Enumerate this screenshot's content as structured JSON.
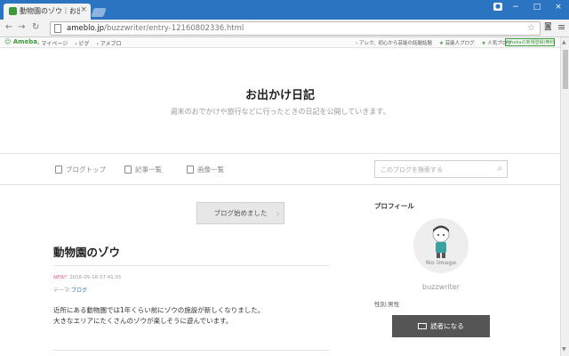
{
  "browser": {
    "tab_title": "動物園のゾウ｜お出かけ日記",
    "tab_close": "×",
    "url_host": "ameblo.jp",
    "url_path": "/buzzwriter/entry-12160802336.html",
    "window_buttons": [
      "−",
      "□",
      "×"
    ]
  },
  "ameba_bar": {
    "logo": "Ameba",
    "nav": [
      "マイページ",
      "ピグ",
      "アメブロ"
    ],
    "right": [
      "アレク、初心から芸能の話題話題",
      "芸能人ブログ",
      "人気ブログ"
    ],
    "register": "Amebaの新規登録(無料)"
  },
  "blog": {
    "title": "お出かけ日記",
    "description": "週末のおでかけや旅行などに行ったときの日記を公開していきます。",
    "nav": [
      "ブログトップ",
      "記事一覧",
      "画像一覧"
    ],
    "search_placeholder": "このブログを検索する"
  },
  "post": {
    "follow_button": "ブログ始めました",
    "title": "動物園のゾウ",
    "new_label": "NEW!",
    "date": "2016-05-16 07:41:01",
    "theme_label": "テーマ:",
    "theme": "ブログ",
    "body_lines": [
      "近所にある動物園では1年くらい前にゾウの施設が新しくなりました。",
      "大きなエリアにたくさんのゾウが楽しそうに遊んでいます。"
    ]
  },
  "sidebar": {
    "profile_heading": "プロフィール",
    "no_image": "No image",
    "username": "buzzwriter",
    "gender": "性別:男性",
    "reader_button": "読者になる"
  },
  "colors": {
    "chrome_blue": "#2a74c2",
    "ameba_green": "#3d9a3b",
    "new_pink": "#e05a8a",
    "button_dark": "#555555"
  }
}
